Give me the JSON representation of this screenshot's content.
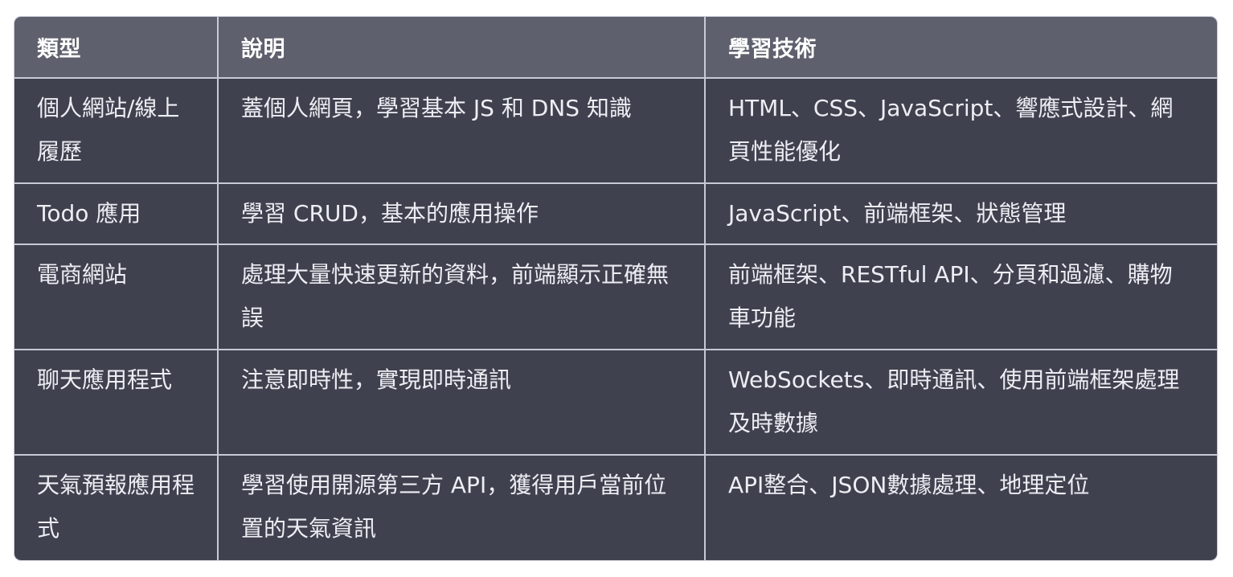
{
  "table": {
    "headers": [
      "類型",
      "說明",
      "學習技術"
    ],
    "rows": [
      [
        "個人網站/線上履歷",
        "蓋個人網頁，學習基本 JS 和 DNS 知識",
        "HTML、CSS、JavaScript、響應式設計、網頁性能優化"
      ],
      [
        "Todo 應用",
        "學習 CRUD，基本的應用操作",
        "JavaScript、前端框架、狀態管理"
      ],
      [
        "電商網站",
        "處理大量快速更新的資料，前端顯示正確無誤",
        "前端框架、RESTful API、分頁和過濾、購物車功能"
      ],
      [
        "聊天應用程式",
        "注意即時性，實現即時通訊",
        "WebSockets、即時通訊、使用前端框架處理及時數據"
      ],
      [
        "天氣預報應用程式",
        "學習使用開源第三方 API，獲得用戶當前位置的天氣資訊",
        "API整合、JSON數據處理、地理定位"
      ]
    ]
  },
  "colors": {
    "header_bg": "#5f606d",
    "cell_bg": "#40414f",
    "border": "#c8cad6",
    "text": "#ffffff"
  }
}
